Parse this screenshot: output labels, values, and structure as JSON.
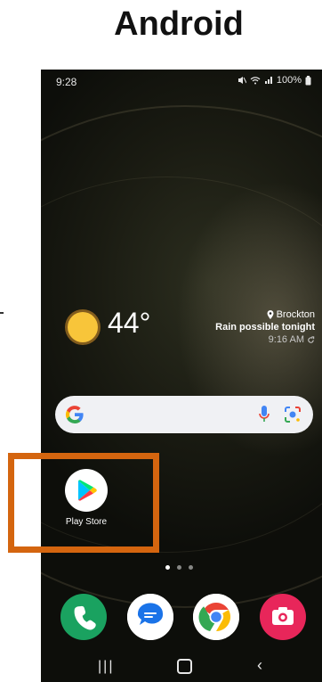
{
  "header": {
    "title": "Android"
  },
  "status_bar": {
    "time": "9:28",
    "battery": "100%"
  },
  "weather": {
    "temperature": "44°",
    "city": "Brockton",
    "forecast": "Rain possible tonight",
    "updated": "9:16 AM"
  },
  "search": {
    "brand": "G"
  },
  "home_apps": [
    {
      "label": "Play Store"
    }
  ],
  "page_indicator": {
    "count": 3,
    "active": 0
  },
  "dock": [
    {
      "name": "phone-icon"
    },
    {
      "name": "messages-icon"
    },
    {
      "name": "chrome-icon"
    },
    {
      "name": "camera-icon"
    }
  ],
  "colors": {
    "highlight": "#d4650f",
    "phone": "#1aa260",
    "camera": "#e8265a"
  }
}
